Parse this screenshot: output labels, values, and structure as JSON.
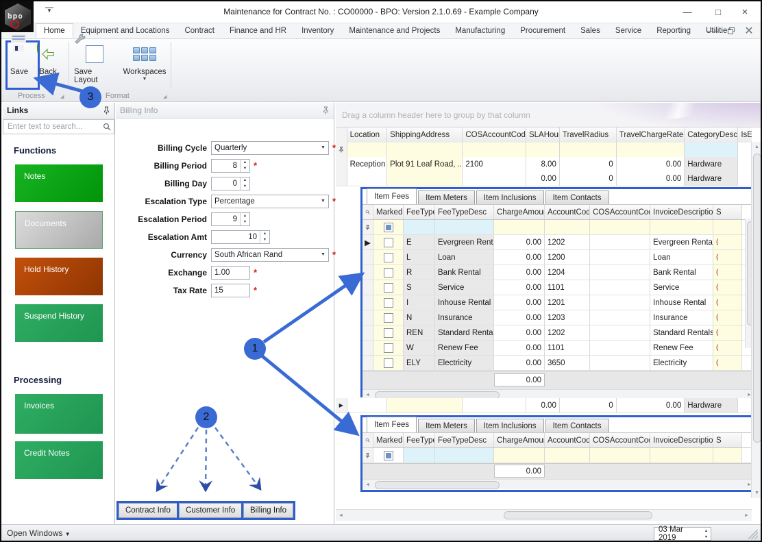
{
  "window": {
    "title": "Maintenance for Contract No. : CO00000    - BPO: Version 2.1.0.69 - Example Company",
    "logo_text": "bpo",
    "controls": {
      "minimize": "—",
      "maximize": "□",
      "close": "×"
    }
  },
  "ribbon": {
    "tabs": [
      "Home",
      "Equipment and Locations",
      "Contract",
      "Finance and HR",
      "Inventory",
      "Maintenance and Projects",
      "Manufacturing",
      "Procurement",
      "Sales",
      "Service",
      "Reporting",
      "Utilities"
    ],
    "active_tab": "Home",
    "buttons": {
      "save": "Save",
      "back": "Back",
      "save_layout": "Save Layout",
      "workspaces": "Workspaces"
    },
    "groups": {
      "process": "Process",
      "format": "Format"
    }
  },
  "sidebar": {
    "title": "Links",
    "search_placeholder": "Enter text to search...",
    "sections": [
      {
        "heading": "Functions",
        "buttons": [
          {
            "label": "Notes"
          },
          {
            "label": "Documents"
          },
          {
            "label": "Hold History"
          },
          {
            "label": "Suspend History"
          }
        ]
      },
      {
        "heading": "Processing",
        "buttons": [
          {
            "label": "Invoices"
          },
          {
            "label": "Credit Notes"
          }
        ]
      }
    ]
  },
  "billing": {
    "panel_title": "Billing Info",
    "fields": [
      {
        "label": "Billing Cycle",
        "value": "Quarterly",
        "required": "*"
      },
      {
        "label": "Billing Period",
        "value": "8",
        "required": "*"
      },
      {
        "label": "Billing Day",
        "value": "0",
        "required": ""
      },
      {
        "label": "Escalation Type",
        "value": "Percentage",
        "required": "*"
      },
      {
        "label": "Escalation Period",
        "value": "9",
        "required": ""
      },
      {
        "label": "Escalation Amt",
        "value": "10",
        "required": ""
      },
      {
        "label": "Currency",
        "value": "South African Rand",
        "required": "*"
      },
      {
        "label": "Exchange",
        "value": "1.00",
        "required": "*"
      },
      {
        "label": "Tax Rate",
        "value": "15",
        "required": "*"
      }
    ],
    "bottom_tabs": [
      "Contract Info",
      "Customer Info",
      "Billing Info"
    ]
  },
  "grid": {
    "group_by_hint": "Drag a column header here to group by that column",
    "columns": [
      "Location",
      "ShippingAddress",
      "COSAccountCode",
      "SLAHours",
      "TravelRadius",
      "TravelChargeRate",
      "CategoryDesc",
      "IsE"
    ],
    "rows": [
      {
        "location": "Reception",
        "shipping": "Plot 91 Leaf Road, ...",
        "cos": "2100",
        "sla": "8.00",
        "radius": "0",
        "rate": "0.00",
        "category": "Hardware"
      },
      {
        "location": "",
        "shipping": "",
        "cos": "",
        "sla": "0.00",
        "radius": "0",
        "rate": "0.00",
        "category": "Hardware"
      },
      {
        "location": "",
        "shipping": "",
        "cos": "",
        "sla": "0.00",
        "radius": "0",
        "rate": "0.00",
        "category": "Hardware"
      }
    ]
  },
  "detail": {
    "tabs": [
      "Item Fees",
      "Item Meters",
      "Item Inclusions",
      "Item Contacts"
    ],
    "active_tab": "Item Fees",
    "columns": [
      "Marked",
      "FeeType",
      "FeeTypeDesc",
      "ChargeAmount",
      "AccountCode",
      "COSAccountCode",
      "InvoiceDescription"
    ],
    "clipped_header": "S",
    "clipped_cell": "(",
    "rows": [
      {
        "fee": "E",
        "desc": "Evergreen Rental",
        "charge": "0.00",
        "acct": "1202",
        "cos": "",
        "inv": "Evergreen Rental"
      },
      {
        "fee": "L",
        "desc": "Loan",
        "charge": "0.00",
        "acct": "1200",
        "cos": "",
        "inv": "Loan"
      },
      {
        "fee": "R",
        "desc": "Bank Rental",
        "charge": "0.00",
        "acct": "1204",
        "cos": "",
        "inv": "Bank Rental"
      },
      {
        "fee": "S",
        "desc": "Service",
        "charge": "0.00",
        "acct": "1101",
        "cos": "",
        "inv": "Service"
      },
      {
        "fee": "I",
        "desc": "Inhouse Rental",
        "charge": "0.00",
        "acct": "1201",
        "cos": "",
        "inv": "Inhouse Rental"
      },
      {
        "fee": "N",
        "desc": "Insurance",
        "charge": "0.00",
        "acct": "1203",
        "cos": "",
        "inv": "Insurance"
      },
      {
        "fee": "REN",
        "desc": "Standard Rentals",
        "charge": "0.00",
        "acct": "1202",
        "cos": "",
        "inv": "Standard Rentals"
      },
      {
        "fee": "W",
        "desc": "Renew Fee",
        "charge": "0.00",
        "acct": "1101",
        "cos": "",
        "inv": "Renew Fee"
      },
      {
        "fee": "ELY",
        "desc": "Electricity",
        "charge": "0.00",
        "acct": "3650",
        "cos": "",
        "inv": "Electricity"
      }
    ],
    "summary": "0.00"
  },
  "detail2": {
    "summary": "0.00"
  },
  "status_bar": {
    "open_windows": "Open Windows",
    "date": "03 Mar 2019"
  },
  "annotations": {
    "one": "1",
    "two": "2",
    "three": "3"
  },
  "colors": {
    "annotation_blue": "#3a6ad4",
    "highlight_border": "#2f5fce",
    "notes_green": "#17b422",
    "function_green": "#2fae63",
    "hold_rust": "#c3500c",
    "documents_silver": "#c9c9c9",
    "filter_yellow": "#fffde1",
    "filter_cyan": "#def2f9",
    "required_red": "#cc2020"
  }
}
